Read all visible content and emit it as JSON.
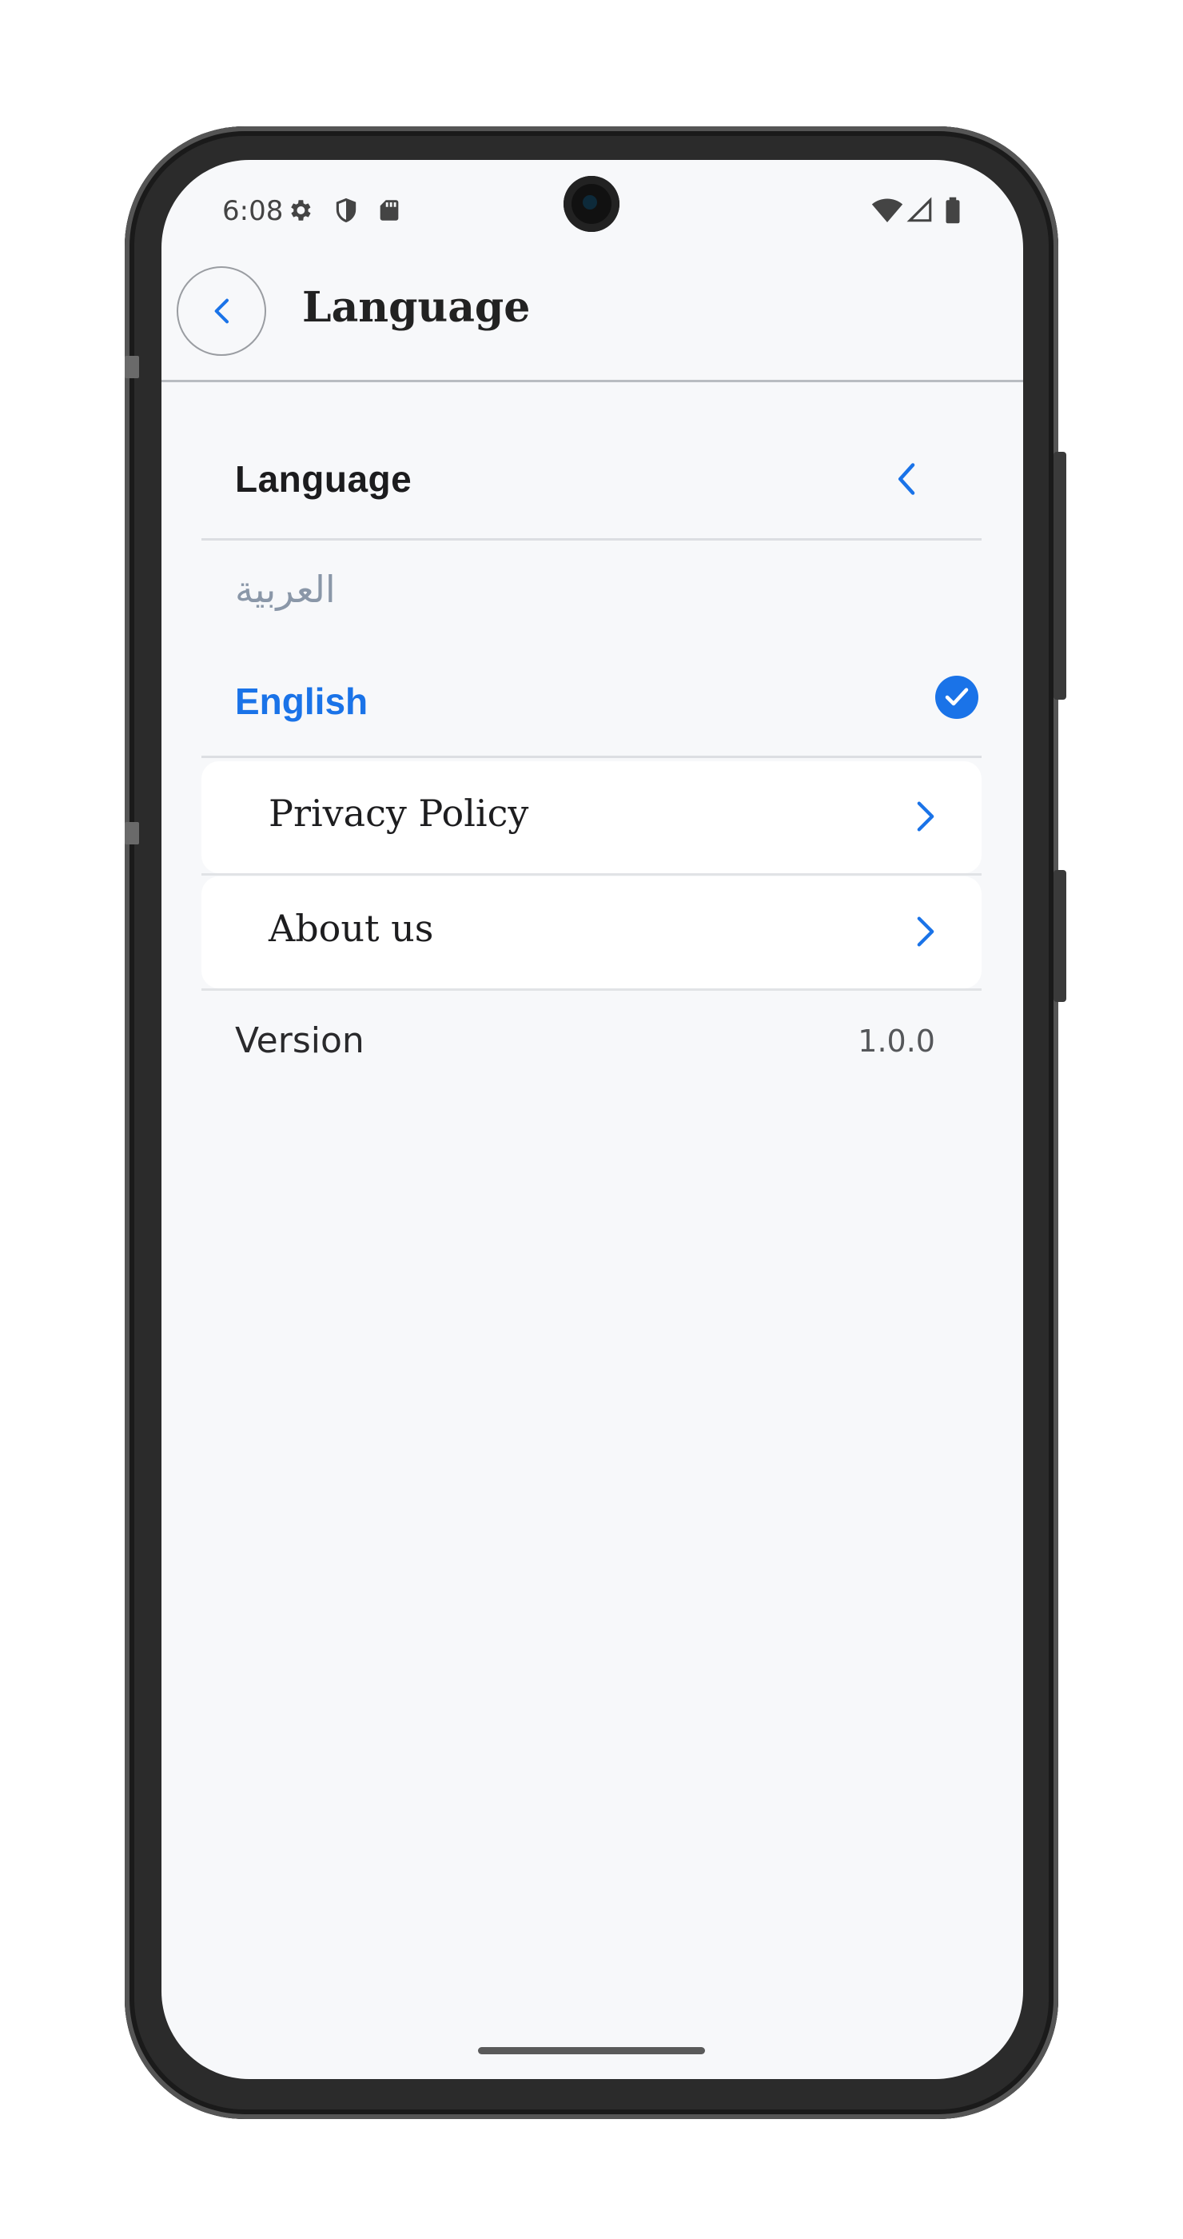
{
  "status_bar": {
    "time": "6:08",
    "left_icons": [
      "gear-icon",
      "shield-icon",
      "sd-card-icon"
    ],
    "right_icons": [
      "wifi-icon",
      "signal-icon",
      "battery-icon"
    ]
  },
  "app_bar": {
    "title": "Language",
    "back_icon": "chevron-left-icon"
  },
  "language_section": {
    "header_label": "Language",
    "expanded_icon": "chevron-left-icon",
    "options": [
      {
        "label": "العربية",
        "selected": false
      },
      {
        "label": "English",
        "selected": true
      }
    ]
  },
  "menu_items": [
    {
      "label": "Privacy Policy",
      "icon": "chevron-right-icon"
    },
    {
      "label": "About us",
      "icon": "chevron-right-icon"
    }
  ],
  "version": {
    "label": "Version",
    "value": "1.0.0"
  },
  "colors": {
    "accent": "#1a73e8",
    "background": "#f7f8fa",
    "card": "#ffffff",
    "muted_text": "#8a97a8"
  }
}
